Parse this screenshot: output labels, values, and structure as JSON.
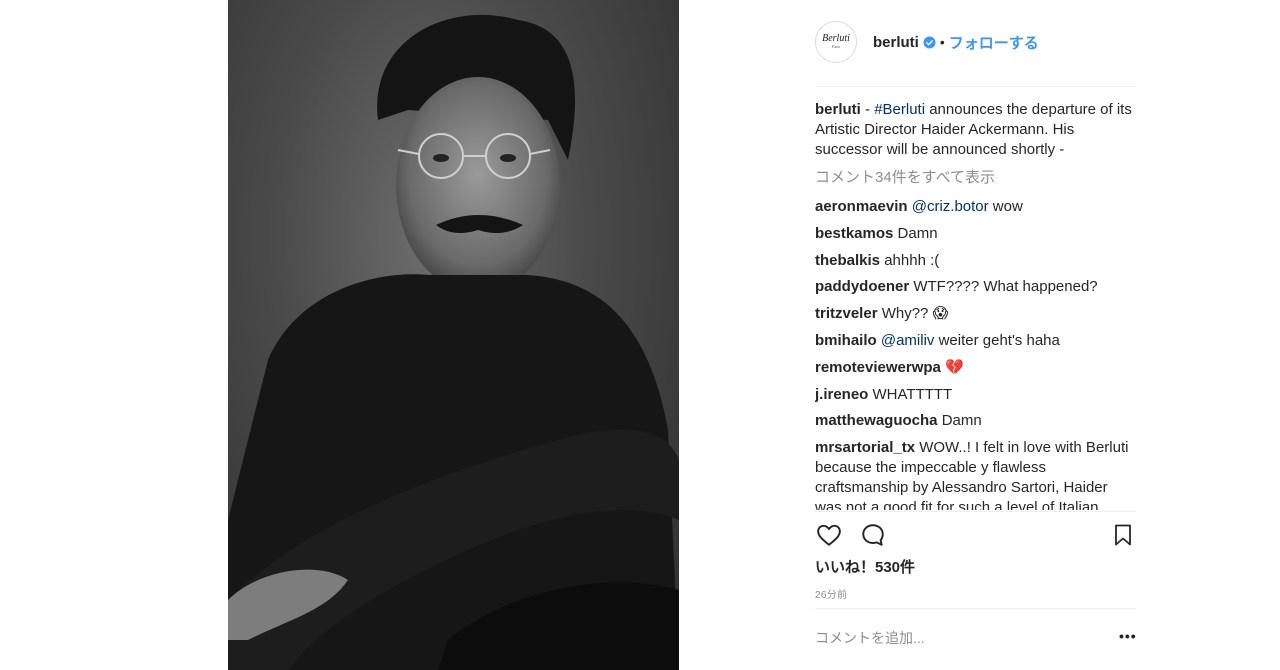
{
  "post": {
    "username": "berluti",
    "avatar_text": "Berluti",
    "avatar_subtext": "Paris",
    "follow_label": "フォローする",
    "separator": "•",
    "caption_username": "berluti",
    "caption_dash": " - ",
    "caption_hashtag": "#Berluti",
    "caption_text": " announces the departure of its Artistic Director Haider Ackermann. His successor will be announced shortly -",
    "view_all_comments": "コメント34件をすべて表示",
    "likes": "いいね！530件",
    "timestamp": "26分前",
    "add_comment_placeholder": "コメントを追加...",
    "more_label": "•••",
    "accent_color": "#3897f0",
    "link_color": "#003569"
  },
  "comments": [
    {
      "user": "aeronmaevin",
      "mention": "@criz.botor",
      "text": " wow"
    },
    {
      "user": "bestkamos",
      "mention": "",
      "text": " Damn"
    },
    {
      "user": "thebalkis",
      "mention": "",
      "text": " ahhhh :("
    },
    {
      "user": "paddydoener",
      "mention": "",
      "text": " WTF???? What happened?"
    },
    {
      "user": "tritzveler",
      "mention": "",
      "text": " Why?? 😱"
    },
    {
      "user": "bmihailo",
      "mention": "@amiliv",
      "text": " weiter geht's haha"
    },
    {
      "user": "remoteviewerwpa",
      "mention": "",
      "text": " 💔"
    },
    {
      "user": "j.ireneo",
      "mention": "",
      "text": " WHATTTTT"
    },
    {
      "user": "matthewaguocha",
      "mention": "",
      "text": " Damn"
    },
    {
      "user": "mrsartorial_tx",
      "mention": "",
      "text": " WOW..! I felt in love with Berluti because the impeccable y flawless craftsmanship by Alessandro Sartori, Haider was not a good fit for such a level of Italian"
    }
  ],
  "icons": {
    "verified": "verified-badge-icon",
    "like": "heart-icon",
    "comment": "comment-bubble-icon",
    "save": "bookmark-icon"
  }
}
